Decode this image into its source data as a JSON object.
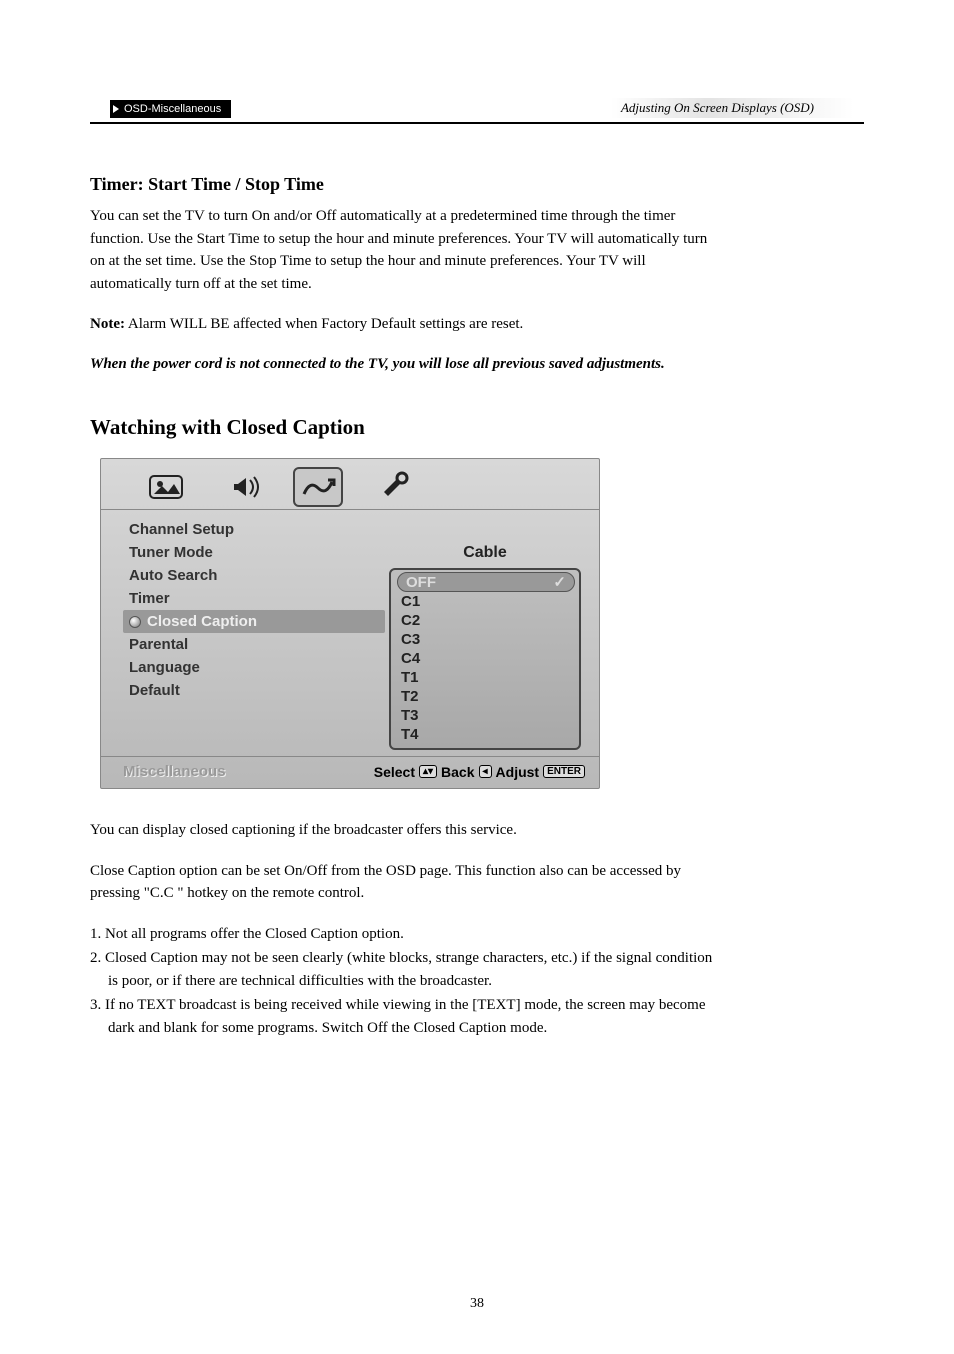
{
  "header": {
    "tab": "OSD-Miscellaneous",
    "right": "Adjusting On Screen Displays (OSD)"
  },
  "timer": {
    "title": "Timer: Start Time / Stop Time",
    "para": "You can set the TV to turn On and/or Off automatically at a predetermined time through the timer function. Use the Start Time to setup the hour and minute preferences. Your TV will automatically turn on at the set time. Use the Stop Time to setup the hour and minute preferences. Your TV will automatically turn off at the set time.",
    "note_label": "Note:",
    "note_text": " Alarm WILL BE affected when Factory Default settings are reset.",
    "warning": "When the power cord is not connected to the TV, you will lose all previous saved adjustments."
  },
  "cc": {
    "title": "Watching with Closed Caption",
    "osd": {
      "menu": [
        "Channel Setup",
        "Tuner Mode",
        "Auto Search",
        "Timer",
        "Closed Caption",
        "Parental",
        "Language",
        "Default"
      ],
      "tuner_value": "Cable",
      "options": [
        "OFF",
        "C1",
        "C2",
        "C3",
        "C4",
        "T1",
        "T2",
        "T3",
        "T4"
      ],
      "footer_title": "Miscellaneous",
      "hint_select": "Select",
      "hint_back": "Back",
      "hint_adjust": "Adjust",
      "hint_enter": "ENTER"
    },
    "para1": "You can display closed captioning if the broadcaster offers this service.",
    "para2": "Close Caption option can be set On/Off from the OSD page. This function also can be accessed by pressing \"C.C \" hotkey on the remote control.",
    "notes": [
      "1. Not all programs offer the Closed Caption option.",
      "2. Closed Caption may not be seen clearly (white blocks, strange characters, etc.) if the signal condition is poor, or if there are technical difficulties with the broadcaster.",
      "3. If no TEXT broadcast is being received while viewing in the [TEXT] mode, the screen may become dark and blank for some programs. Switch Off the Closed Caption mode."
    ]
  },
  "page_number": "38"
}
